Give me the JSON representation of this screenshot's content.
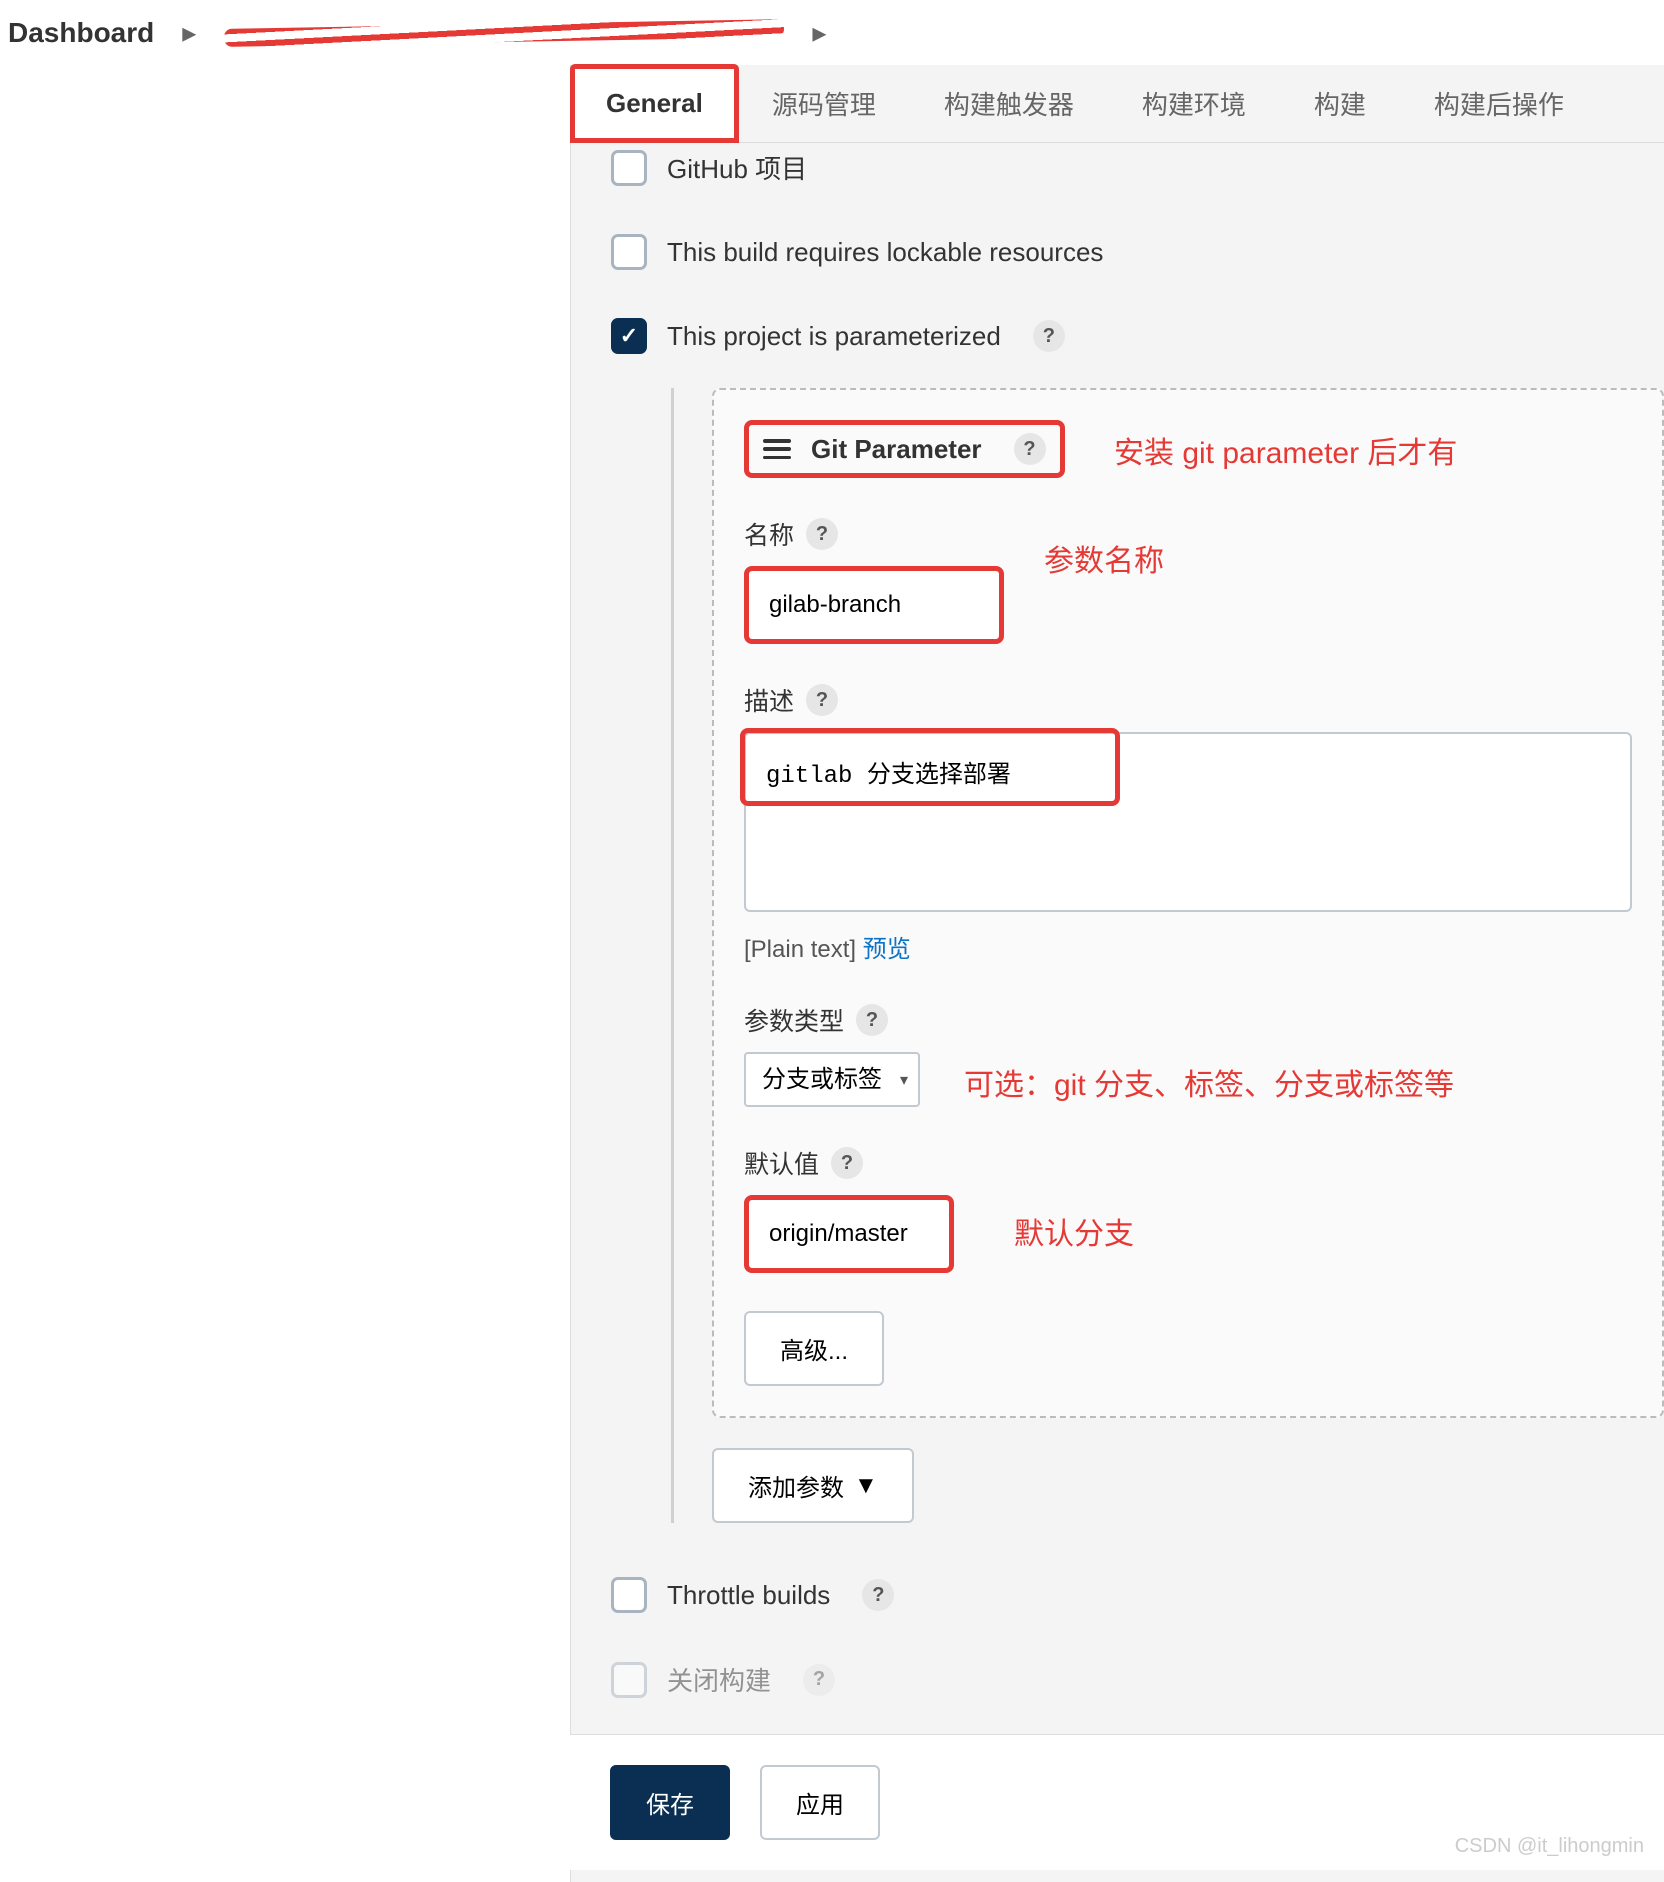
{
  "breadcrumb": {
    "root": "Dashboard"
  },
  "tabs": {
    "general": "General",
    "scm": "源码管理",
    "triggers": "构建触发器",
    "env": "构建环境",
    "build": "构建",
    "post": "构建后操作"
  },
  "checkboxes": {
    "github_project": "GitHub 项目",
    "lockable": "This build requires lockable resources",
    "parameterized": "This project is parameterized",
    "throttle": "Throttle builds",
    "close_build": "关闭构建"
  },
  "git_param": {
    "title": "Git Parameter",
    "name_label": "名称",
    "name_value": "gilab-branch",
    "desc_label": "描述",
    "desc_value": "gitlab 分支选择部署",
    "plain_text": "[Plain text]",
    "preview": "预览",
    "type_label": "参数类型",
    "type_value": "分支或标签",
    "default_label": "默认值",
    "default_value": "origin/master",
    "advanced": "高级..."
  },
  "add_param": "添加参数",
  "annotations": {
    "install_note": "安装 git parameter 后才有",
    "param_name": "参数名称",
    "type_options": "可选：git 分支、标签、分支或标签等",
    "default_branch": "默认分支"
  },
  "footer": {
    "save": "保存",
    "apply": "应用"
  },
  "watermark": "CSDN @it_lihongmin"
}
